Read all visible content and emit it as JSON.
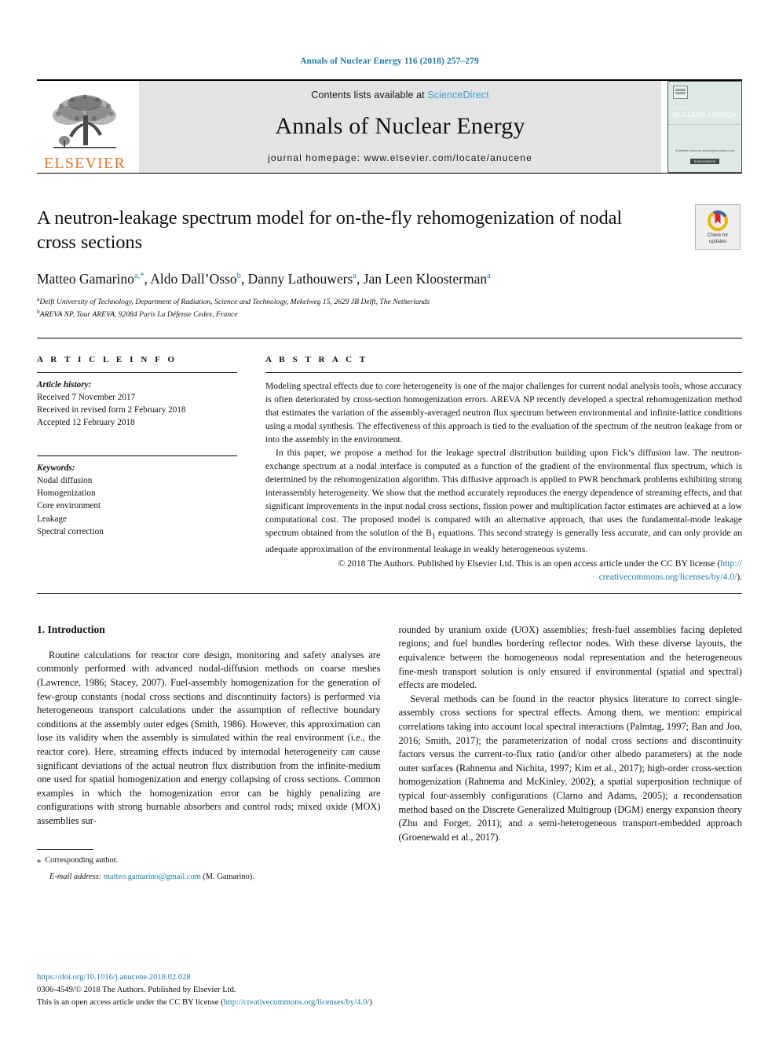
{
  "running_head": "Annals of Nuclear Energy 116 (2018) 257–279",
  "masthead": {
    "publisher_logo_label": "ELSEVIER",
    "contents_prefix": "Contents lists available at ",
    "contents_link": "ScienceDirect",
    "journal_name": "Annals of Nuclear Energy",
    "homepage": "journal homepage: www.elsevier.com/locate/anucene",
    "cover": {
      "small_title": "Annals of",
      "big_title": "NUCLEAR ENERGY",
      "footer_line": "Available online at www.sciencedirect.com",
      "badge": "ScienceDirect"
    }
  },
  "title": "A neutron-leakage spectrum model for on-the-fly rehomogenization of nodal cross sections",
  "crossmark": {
    "line1": "Check for",
    "line2": "updates"
  },
  "authors": [
    {
      "name": "Matteo Gamarino",
      "marks": "a,*"
    },
    {
      "name": "Aldo Dall’Osso",
      "marks": "b"
    },
    {
      "name": "Danny Lathouwers",
      "marks": "a"
    },
    {
      "name": "Jan Leen Kloosterman",
      "marks": "a"
    }
  ],
  "affiliations": [
    {
      "mark": "a",
      "text": "Delft University of Technology, Department of Radiation, Science and Technology, Mekelweg 15, 2629 JB Delft, The Netherlands"
    },
    {
      "mark": "b",
      "text": "AREVA NP, Tour AREVA, 92084 Paris La Défense Cedex, France"
    }
  ],
  "article_info": {
    "heading": "A R T I C L E  I N F O",
    "history_label": "Article history:",
    "history": [
      "Received 7 November 2017",
      "Received in revised form 2 February 2018",
      "Accepted 12 February 2018"
    ],
    "keywords_label": "Keywords:",
    "keywords": [
      "Nodal diffusion",
      "Homogenization",
      "Core environment",
      "Leakage",
      "Spectral correction"
    ]
  },
  "abstract": {
    "heading": "A B S T R A C T",
    "para1": "Modeling spectral effects due to core heterogeneity is one of the major challenges for current nodal analysis tools, whose accuracy is often deteriorated by cross-section homogenization errors. AREVA NP recently developed a spectral rehomogenization method that estimates the variation of the assembly-averaged neutron flux spectrum between environmental and infinite-lattice conditions using a modal synthesis. The effectiveness of this approach is tied to the evaluation of the spectrum of the neutron leakage from or into the assembly in the environment.",
    "para2_a": "In this paper, we propose a method for the leakage spectral distribution building upon Fick’s diffusion law. The neutron-exchange spectrum at a nodal interface is computed as a function of the gradient of the environmental flux spectrum, which is determined by the rehomogenization algorithm. This diffusive approach is applied to PWR benchmark problems exhibiting strong interassembly heterogeneity. We show that the method accurately reproduces the energy dependence of streaming effects, and that significant improvements in the input nodal cross sections, fission power and multiplication factor estimates are achieved at a low computational cost. The proposed model is compared with an alternative approach, that uses the fundamental-mode leakage spectrum obtained from the solution of the B",
    "para2_sub": "1",
    "para2_b": " equations. This second strategy is generally less accurate, and can only provide an adequate approximation of the environmental leakage in weakly heterogeneous systems.",
    "copyright": "© 2018 The Authors. Published by Elsevier Ltd. This is an open access article under the CC BY license (",
    "copyright_link1": "http://",
    "copyright_link2": "creativecommons.org/licenses/by/4.0/",
    "copyright_end": ")."
  },
  "body": {
    "section_heading": "1. Introduction",
    "left_paragraph": "Routine calculations for reactor core design, monitoring and safety analyses are commonly performed with advanced nodal-diffusion methods on coarse meshes (Lawrence, 1986; Stacey, 2007). Fuel-assembly homogenization for the generation of few-group constants (nodal cross sections and discontinuity factors) is performed via heterogeneous transport calculations under the assumption of reflective boundary conditions at the assembly outer edges (Smith, 1986). However, this approximation can lose its validity when the assembly is simulated within the real environment (i.e., the reactor core). Here, streaming effects induced by internodal heterogeneity can cause significant deviations of the actual neutron flux distribution from the infinite-medium one used for spatial homogenization and energy collapsing of cross sections. Common examples in which the homogenization error can be highly penalizing are configurations with strong burnable absorbers and control rods; mixed oxide (MOX) assemblies sur-",
    "right_paragraph_1": "rounded by uranium oxide (UOX) assemblies; fresh-fuel assemblies facing depleted regions; and fuel bundles bordering reflector nodes. With these diverse layouts, the equivalence between the homogeneous nodal representation and the heterogeneous fine-mesh transport solution is only ensured if environmental (spatial and spectral) effects are modeled.",
    "right_paragraph_2": "Several methods can be found in the reactor physics literature to correct single-assembly cross sections for spectral effects. Among them, we mention: empirical correlations taking into account local spectral interactions (Palmtag, 1997; Ban and Joo, 2016; Smith, 2017); the parameterization of nodal cross sections and discontinuity factors versus the current-to-flux ratio (and/or other albedo parameters) at the node outer surfaces (Rahnema and Nichita, 1997; Kim et al., 2017); high-order cross-section homogenization (Rahnema and McKinley, 2002); a spatial superposition technique of typical four-assembly configurations (Clarno and Adams, 2005); a recondensation method based on the Discrete Generalized Multigroup (DGM) energy expansion theory (Zhu and Forget, 2011); and a semi-heterogeneous transport-embedded approach (Groenewald et al., 2017)."
  },
  "footnote": {
    "star": "⁎",
    "corresponding": "Corresponding author.",
    "email_label": "E-mail address:",
    "email": "matteo.gamarino@gmail.com",
    "email_suffix": "(M. Gamarino)."
  },
  "page_footer": {
    "doi": "https://doi.org/10.1016/j.anucene.2018.02.028",
    "issn_line": "0306-4549/© 2018 The Authors. Published by Elsevier Ltd.",
    "license_pre": "This is an open access article under the CC BY license (",
    "license_link": "http://creativecommons.org/licenses/by/4.0/",
    "license_post": ")"
  },
  "colors": {
    "link": "#1b7ca8",
    "elsevier_orange": "#E87722",
    "masthead_gray": "#e3e3e3",
    "cover_green": "#dceae3"
  }
}
